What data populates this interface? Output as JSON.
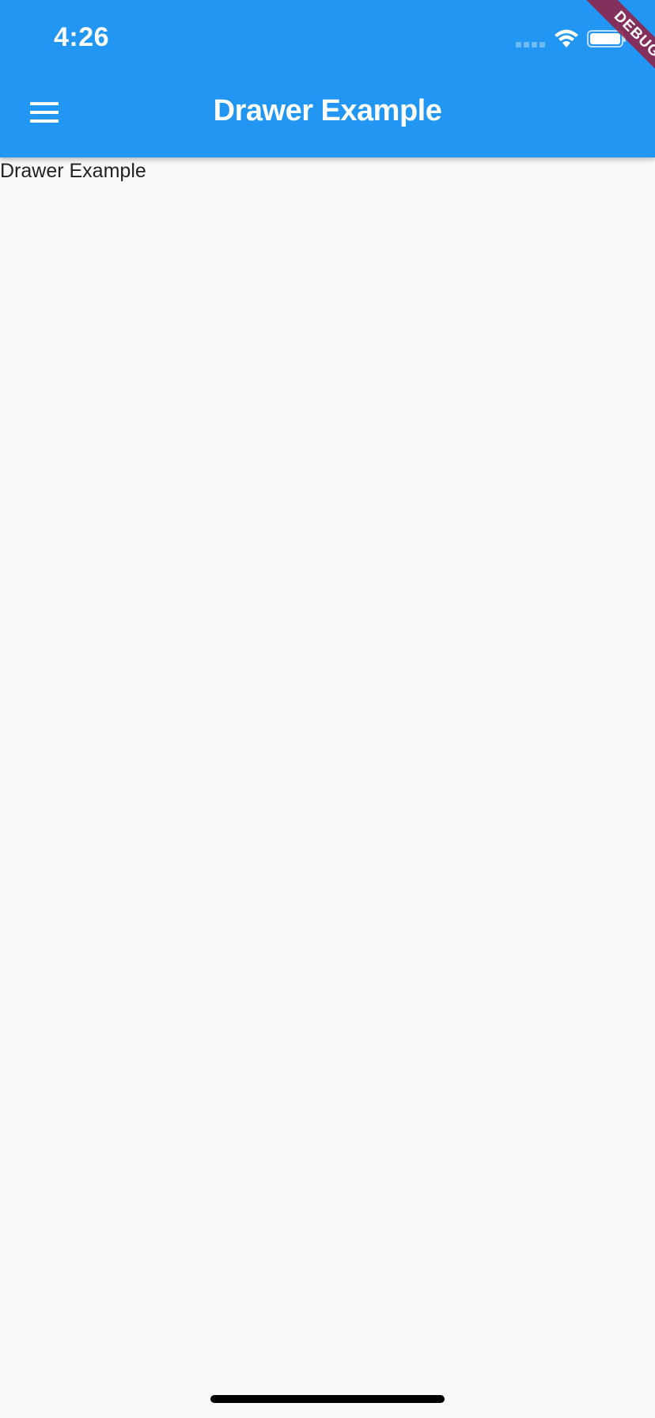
{
  "status_bar": {
    "time": "4:26",
    "icons": [
      "signal-icon",
      "wifi-icon",
      "battery-icon"
    ]
  },
  "app_bar": {
    "title": "Drawer Example",
    "menu_icon": "menu-icon",
    "color": "#2196f3"
  },
  "debug_banner": {
    "label": "DEBUG"
  },
  "body": {
    "text": "Drawer Example"
  }
}
